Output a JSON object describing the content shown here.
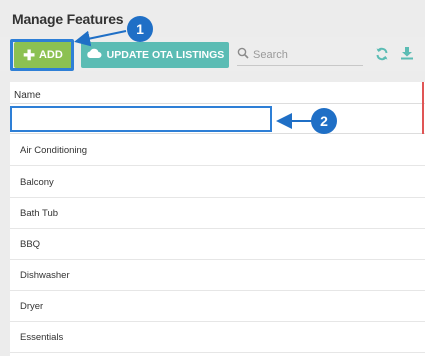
{
  "page": {
    "title": "Manage Features"
  },
  "toolbar": {
    "add_label": "ADD",
    "add_icon": "plus-icon",
    "ota_label": "UPDATE OTA LISTINGS",
    "ota_icon": "cloud-icon",
    "search_placeholder": "Search",
    "search_icon": "search-icon",
    "refresh_icon": "refresh-icon",
    "download_icon": "download-icon"
  },
  "table": {
    "column_header": "Name",
    "new_row_value": "",
    "rows": [
      "Air Conditioning",
      "Balcony",
      "Bath Tub",
      "BBQ",
      "Dishwasher",
      "Dryer",
      "Essentials"
    ]
  },
  "annotations": {
    "callout_1": "1",
    "callout_2": "2"
  },
  "colors": {
    "add_button": "#8cc152",
    "ota_button": "#5bbcb4",
    "highlight": "#2e7fd6",
    "callout": "#1f6fc6",
    "accent_icons": "#5bbcb4",
    "header_marker": "#e05555"
  }
}
